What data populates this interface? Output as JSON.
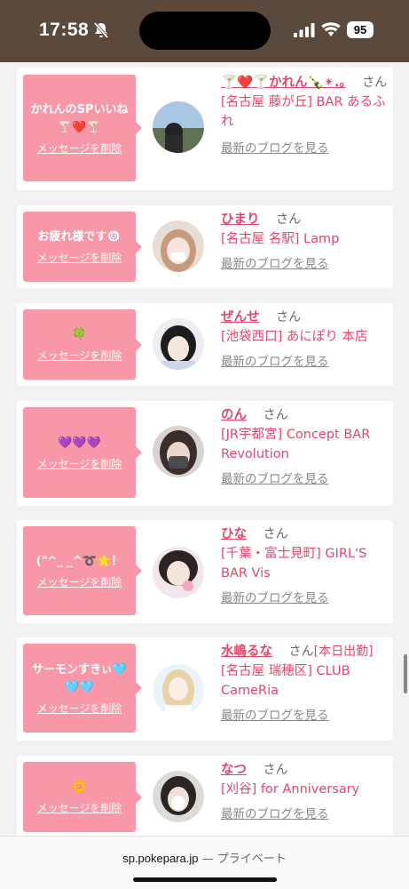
{
  "status": {
    "time": "17:58",
    "battery": "95"
  },
  "labels": {
    "delete": "メッセージを削除",
    "blog": "最新のブログを見る",
    "san": "さん"
  },
  "cards": [
    {
      "message": "かれんのSPいいね🍸❤️🍸",
      "name": "🍸❤️🍸かれん🍾✴︎.｡",
      "shop": "[名古屋 藤が丘] BAR あるふれ",
      "suffix": ""
    },
    {
      "message": "お疲れ様です🍥",
      "name": "ひまり",
      "shop": "[名古屋 名駅] Lamp",
      "suffix": ""
    },
    {
      "message": "🍀",
      "name": "ぜんせ",
      "shop": "[池袋西口] あにぽり 本店",
      "suffix": ""
    },
    {
      "message": "💜💜💜",
      "name": "のん",
      "shop": "[JR宇都宮] Concept BAR Revolution",
      "suffix": ""
    },
    {
      "message": "(\"^_ _^➰🌟！",
      "name": "ひな",
      "shop": "[千葉・富士見町] GIRL'S BAR Vis",
      "suffix": ""
    },
    {
      "message": "サーモンすきぃ🩵🩵🩵",
      "name": "水嶋るな",
      "shop": "[名古屋 瑞穂区] CLUB CameRia",
      "suffix": "[本日出勤]"
    },
    {
      "message": "🌼",
      "name": "なつ",
      "shop": "[刈谷] for Anniversary",
      "suffix": ""
    }
  ],
  "url_bar": {
    "domain": "sp.pokepara.jp",
    "private": "— プライベート"
  }
}
